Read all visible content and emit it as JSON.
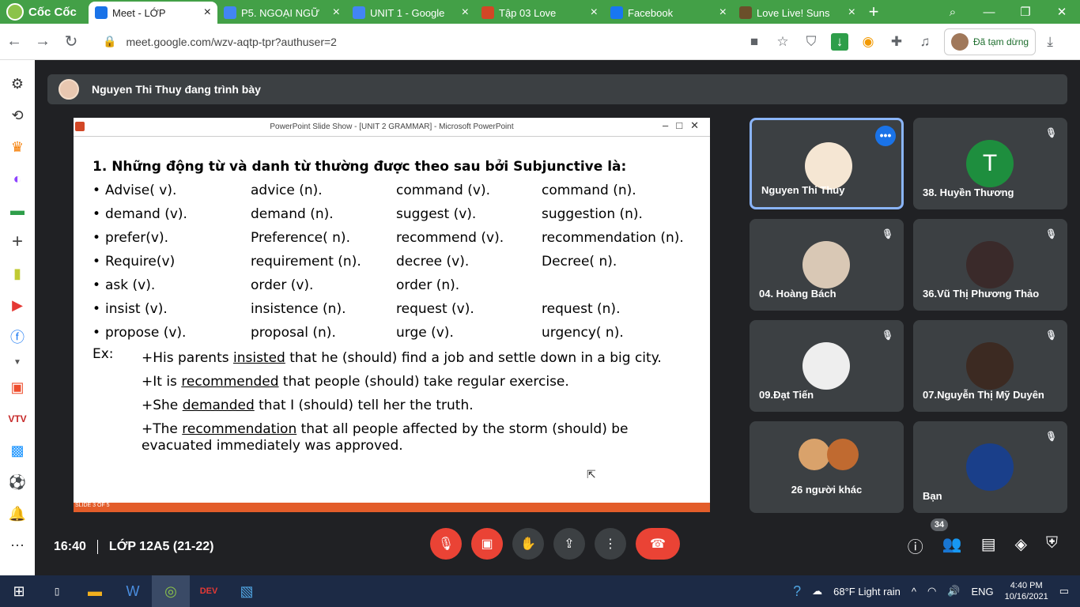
{
  "browser": {
    "brand": "Cốc Cốc",
    "tabs": [
      {
        "title": "Meet - LỚP",
        "active": true,
        "color": "#1a73e8"
      },
      {
        "title": "P5. NGOẠI NGỮ",
        "active": false,
        "color": "#4285f4"
      },
      {
        "title": "UNIT 1 - Google",
        "active": false,
        "color": "#4285f4"
      },
      {
        "title": "Tập 03 Love",
        "active": false,
        "color": "#d24726"
      },
      {
        "title": "Facebook",
        "active": false,
        "color": "#1877f2"
      },
      {
        "title": "Love Live! Suns",
        "active": false,
        "color": "#6b4f2a"
      }
    ],
    "url": "meet.google.com/wzv-aqtp-tpr?authuser=2",
    "profile_status": "Đã tạm dừng"
  },
  "meet": {
    "presenter_banner": "Nguyen Thi Thuy đang trình bày",
    "time": "16:40",
    "meeting_name": "LỚP 12A5 (21-22)",
    "participant_count": "34",
    "participants": [
      {
        "name": "Nguyen Thi Thuy",
        "selected": true
      },
      {
        "name": "38. Huyền Thương",
        "initial": "T",
        "color": "#1e8e3e"
      },
      {
        "name": "04. Hoàng Bách"
      },
      {
        "name": "36.Vũ Thị Phương Thảo"
      },
      {
        "name": "09.Đạt Tiến"
      },
      {
        "name": "07.Nguyễn Thị Mỹ Duyên"
      },
      {
        "name": "26 người khác"
      },
      {
        "name": "Bạn"
      }
    ]
  },
  "slide_window": {
    "title": "PowerPoint Slide Show - [UNIT 2 GRAMMAR] - Microsoft PowerPoint",
    "status": "SLIDE 3 OF 5"
  },
  "slide": {
    "heading": "1. Những động từ và danh từ thường được theo sau bởi Subjunctive là:",
    "rows": [
      [
        "Advise( v).",
        "advice (n).",
        "command (v).",
        "command (n)."
      ],
      [
        "demand (v).",
        "demand (n).",
        "suggest (v).",
        "suggestion (n)."
      ],
      [
        "prefer(v).",
        "Preference( n).",
        "recommend (v).",
        "recommendation (n)."
      ],
      [
        "Require(v)",
        "requirement (n).",
        "decree (v).",
        "Decree( n)."
      ],
      [
        "ask (v).",
        "order (v).",
        "order (n).",
        ""
      ],
      [
        "insist (v).",
        "insistence (n).",
        "request (v).",
        "request (n)."
      ],
      [
        "propose (v).",
        "proposal (n).",
        "urge (v).",
        "urgency( n)."
      ]
    ],
    "ex_label": "Ex:",
    "examples": [
      {
        "pre": "+His parents ",
        "u": "insisted",
        "post": " that he (should) find a job and settle down in a big city."
      },
      {
        "pre": "+It is ",
        "u": "recommended",
        "post": " that people (should) take regular exercise."
      },
      {
        "pre": "+She ",
        "u": "demanded",
        "post": " that I (should) tell her the truth."
      },
      {
        "pre": "+The ",
        "u": "recommendation",
        "post": " that all people affected by the storm (should) be evacuated immediately was approved."
      }
    ]
  },
  "taskbar": {
    "weather": "68°F  Light rain",
    "lang": "ENG",
    "time": "4:40 PM",
    "date": "10/16/2021"
  }
}
